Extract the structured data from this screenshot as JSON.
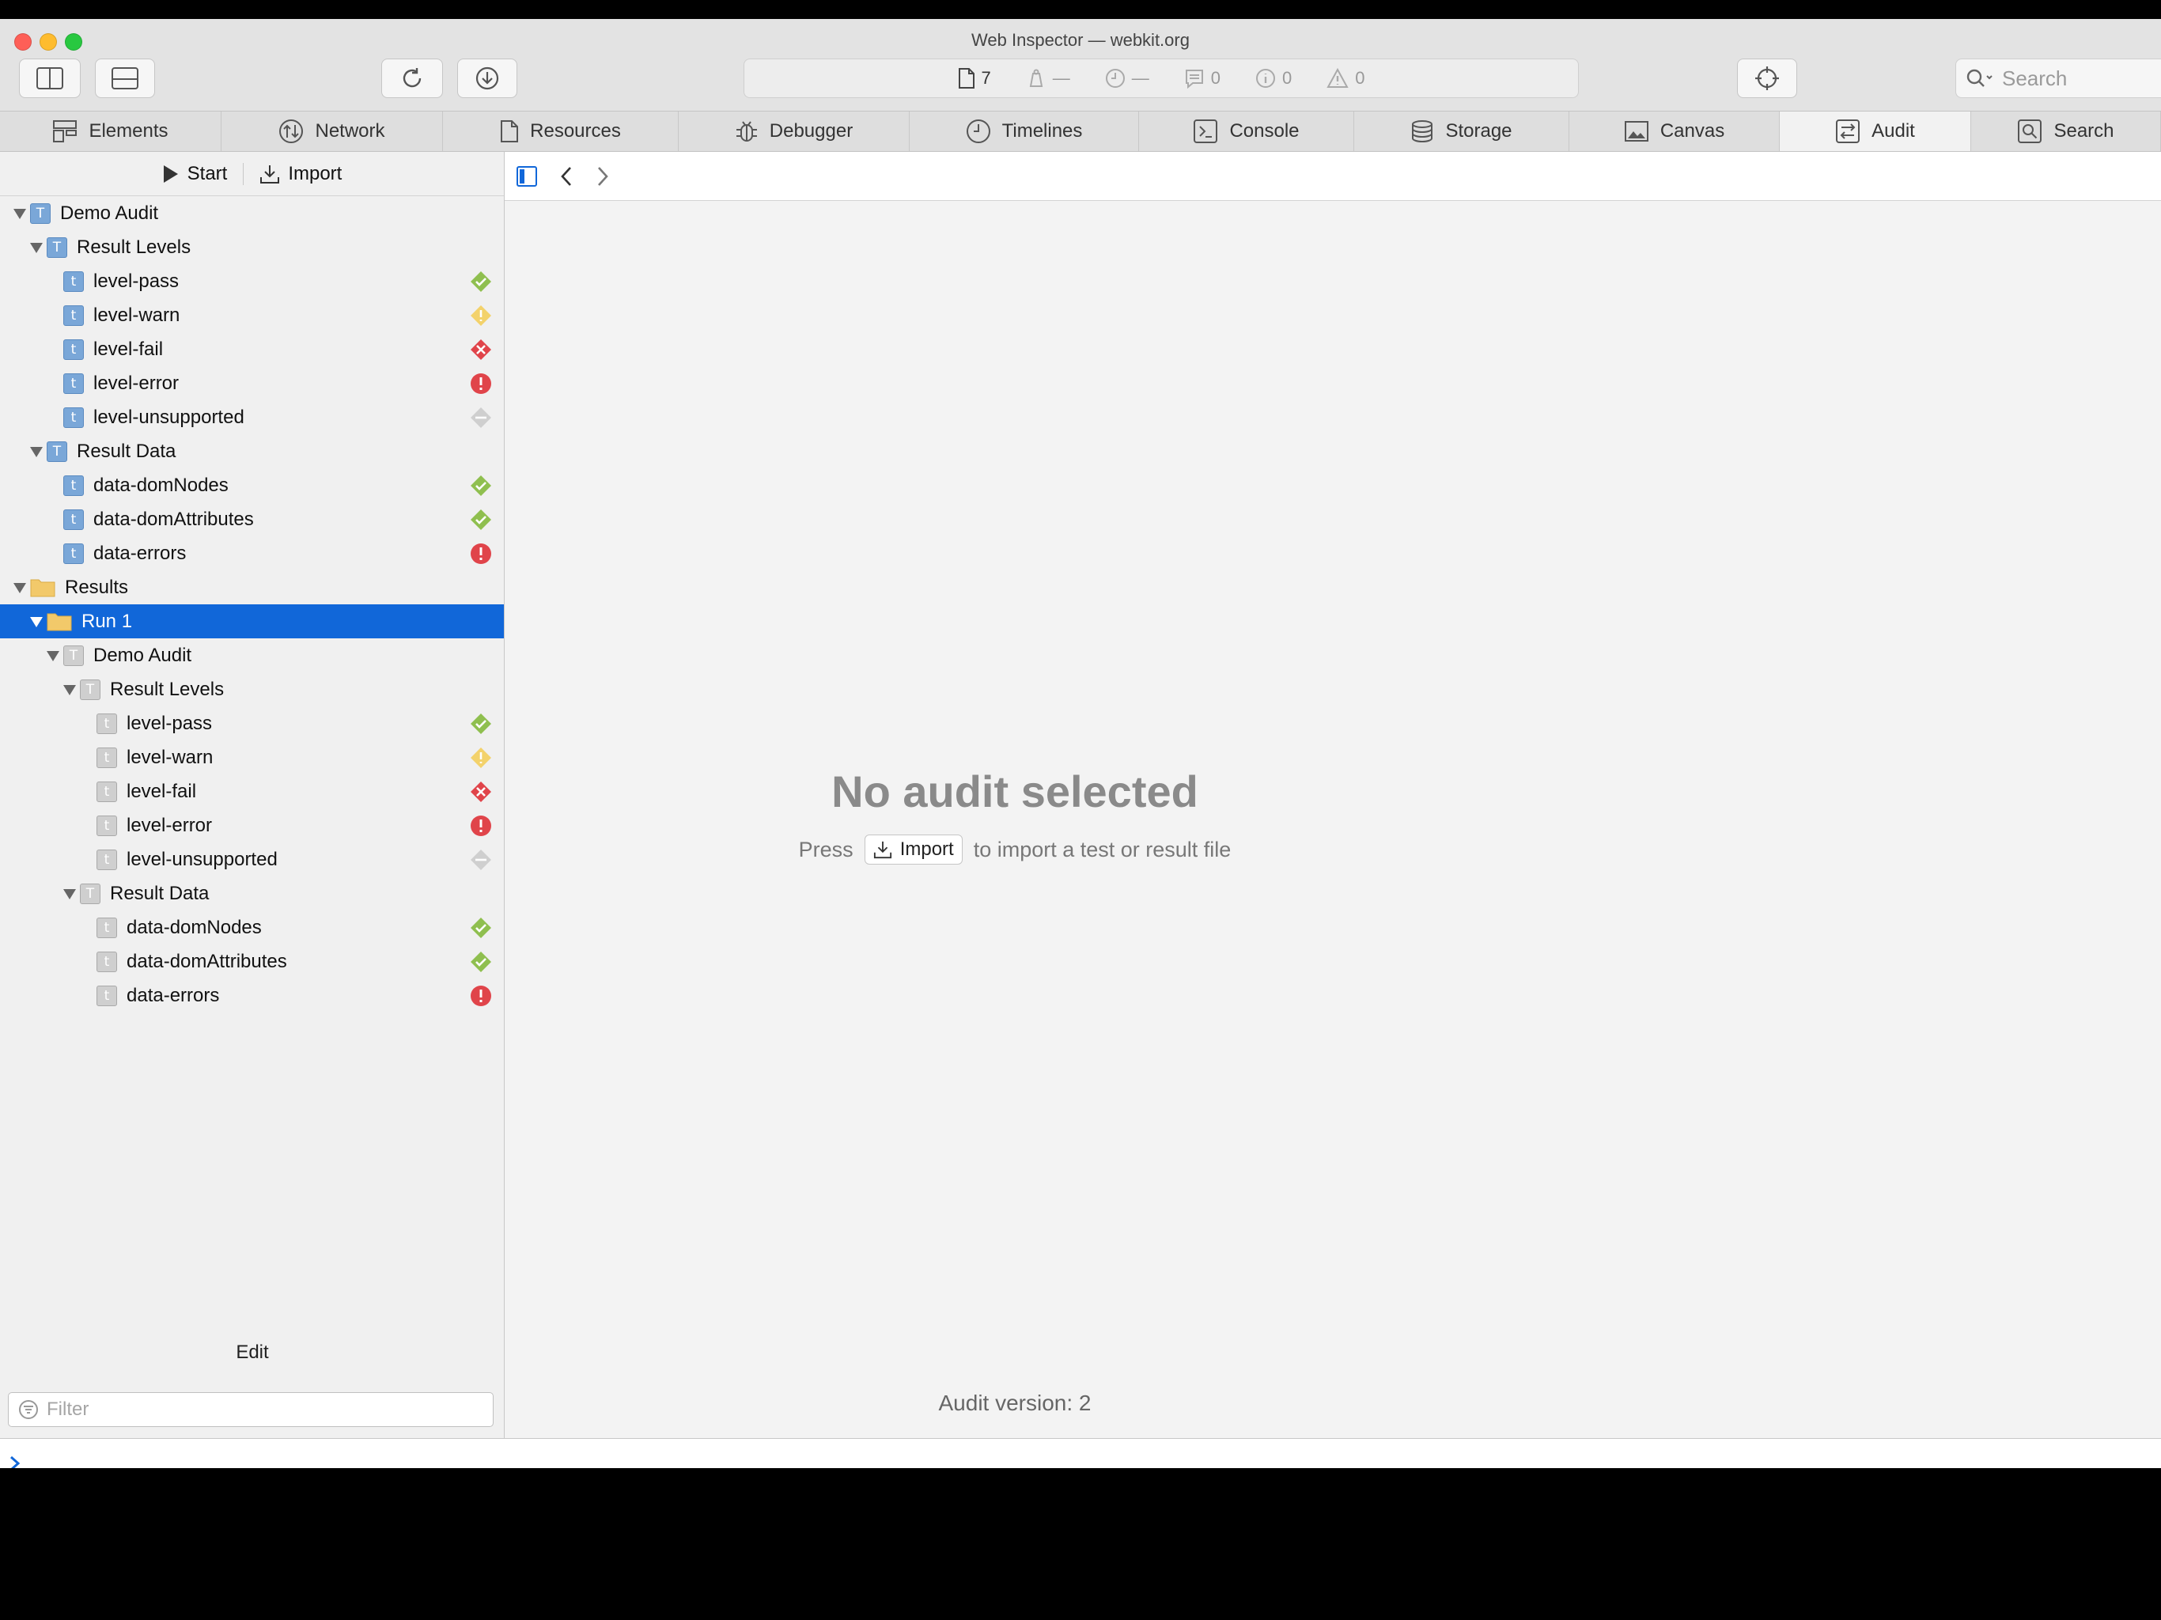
{
  "window": {
    "title": "Web Inspector — webkit.org"
  },
  "colors": {
    "accent": "#1167d9",
    "pass": "#8fbf4f",
    "warn": "#f3d26b",
    "fail": "#e0444a",
    "error": "#e0444a",
    "unsupported": "#bdbdbd"
  },
  "toolbar": {
    "resource_count": "7",
    "load_time": "—",
    "console_logs": "0",
    "console_info": "0",
    "console_warnings": "0",
    "search_placeholder": "Search"
  },
  "tabs": [
    {
      "label": "Elements",
      "icon": "elements-icon"
    },
    {
      "label": "Network",
      "icon": "network-icon"
    },
    {
      "label": "Resources",
      "icon": "resources-icon"
    },
    {
      "label": "Debugger",
      "icon": "debugger-icon"
    },
    {
      "label": "Timelines",
      "icon": "timelines-icon"
    },
    {
      "label": "Console",
      "icon": "console-icon"
    },
    {
      "label": "Storage",
      "icon": "storage-icon"
    },
    {
      "label": "Canvas",
      "icon": "canvas-icon"
    },
    {
      "label": "Audit",
      "icon": "audit-icon"
    },
    {
      "label": "Search",
      "icon": "search-icon"
    }
  ],
  "sidebar": {
    "start_label": "Start",
    "import_label": "Import",
    "edit_label": "Edit",
    "filter_placeholder": "Filter",
    "tree": [
      {
        "label": "Demo Audit",
        "level": 0,
        "icon": "group-blue",
        "expanded": true
      },
      {
        "label": "Result Levels",
        "level": 1,
        "icon": "group-blue",
        "expanded": true
      },
      {
        "label": "level-pass",
        "level": 2,
        "icon": "test-blue",
        "status": "pass"
      },
      {
        "label": "level-warn",
        "level": 2,
        "icon": "test-blue",
        "status": "warn"
      },
      {
        "label": "level-fail",
        "level": 2,
        "icon": "test-blue",
        "status": "fail"
      },
      {
        "label": "level-error",
        "level": 2,
        "icon": "test-blue",
        "status": "error"
      },
      {
        "label": "level-unsupported",
        "level": 2,
        "icon": "test-blue",
        "status": "unsupported"
      },
      {
        "label": "Result Data",
        "level": 1,
        "icon": "group-blue",
        "expanded": true
      },
      {
        "label": "data-domNodes",
        "level": 2,
        "icon": "test-blue",
        "status": "pass"
      },
      {
        "label": "data-domAttributes",
        "level": 2,
        "icon": "test-blue",
        "status": "pass"
      },
      {
        "label": "data-errors",
        "level": 2,
        "icon": "test-blue",
        "status": "error"
      },
      {
        "label": "Results",
        "level": 0,
        "icon": "folder",
        "expanded": true
      },
      {
        "label": "Run 1",
        "level": 1,
        "icon": "folder",
        "expanded": true,
        "selected": true
      },
      {
        "label": "Demo Audit",
        "level": 2,
        "icon": "group-gray",
        "expanded": true
      },
      {
        "label": "Result Levels",
        "level": 3,
        "icon": "group-gray",
        "expanded": true
      },
      {
        "label": "level-pass",
        "level": 4,
        "icon": "test-gray",
        "status": "pass"
      },
      {
        "label": "level-warn",
        "level": 4,
        "icon": "test-gray",
        "status": "warn"
      },
      {
        "label": "level-fail",
        "level": 4,
        "icon": "test-gray",
        "status": "fail"
      },
      {
        "label": "level-error",
        "level": 4,
        "icon": "test-gray",
        "status": "error"
      },
      {
        "label": "level-unsupported",
        "level": 4,
        "icon": "test-gray",
        "status": "unsupported"
      },
      {
        "label": "Result Data",
        "level": 3,
        "icon": "group-gray",
        "expanded": true
      },
      {
        "label": "data-domNodes",
        "level": 4,
        "icon": "test-gray",
        "status": "pass"
      },
      {
        "label": "data-domAttributes",
        "level": 4,
        "icon": "test-gray",
        "status": "pass"
      },
      {
        "label": "data-errors",
        "level": 4,
        "icon": "test-gray",
        "status": "error"
      }
    ]
  },
  "main": {
    "placeholder_title": "No audit selected",
    "press_label": "Press",
    "import_button_label": "Import",
    "hint_suffix": "to import a test or result file",
    "version_text": "Audit version: 2"
  }
}
